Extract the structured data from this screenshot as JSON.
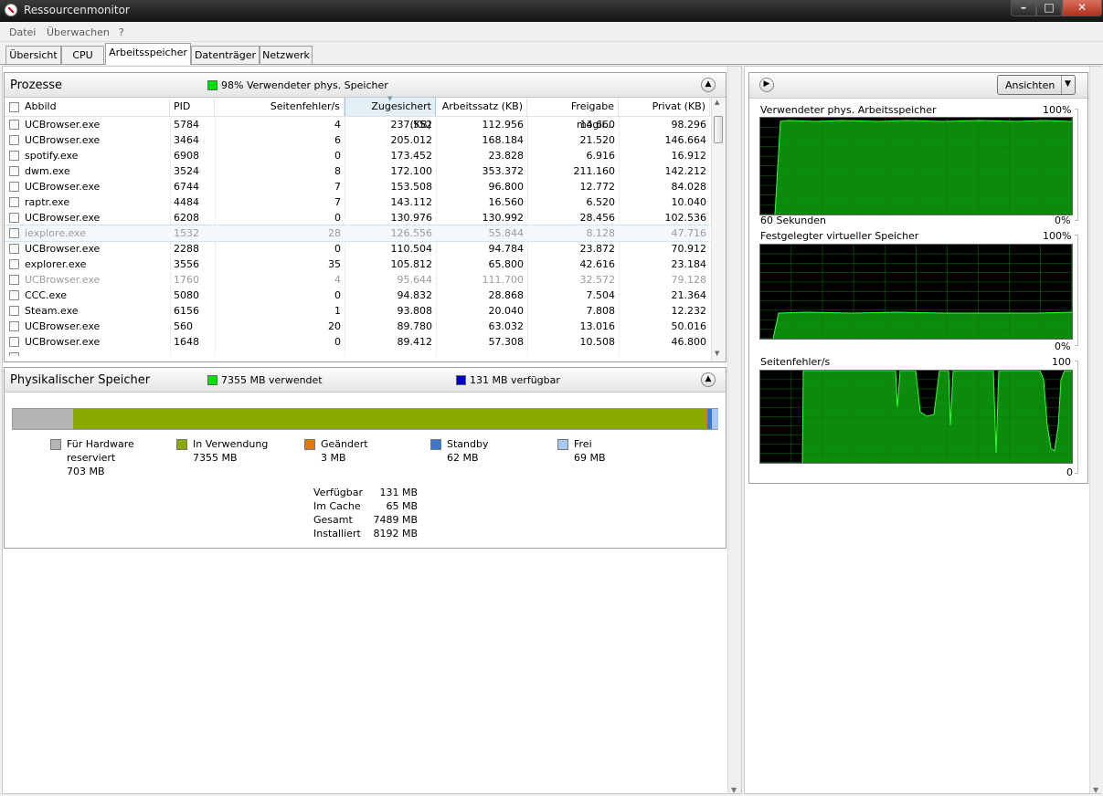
{
  "window": {
    "title": "Ressourcenmonitor"
  },
  "menu": [
    "Datei",
    "Überwachen",
    "?"
  ],
  "tabs": [
    "Übersicht",
    "CPU",
    "Arbeitsspeicher",
    "Datenträger",
    "Netzwerk"
  ],
  "processes": {
    "title": "Prozesse",
    "status": "98% Verwendeter phys. Speicher",
    "status_color": "#00e000",
    "columns": [
      "Abbild",
      "PID",
      "Seitenfehler/s",
      "Zugesichert (KB)",
      "Arbeitssatz (KB)",
      "Freigabe mögli...",
      "Privat (KB)"
    ],
    "rows": [
      {
        "name": "UCBrowser.exe",
        "pid": "5784",
        "faults": "4",
        "commit": "237.552",
        "ws": "112.956",
        "share": "14.660",
        "priv": "98.296",
        "state": "normal"
      },
      {
        "name": "UCBrowser.exe",
        "pid": "3464",
        "faults": "6",
        "commit": "205.012",
        "ws": "168.184",
        "share": "21.520",
        "priv": "146.664",
        "state": "normal"
      },
      {
        "name": "spotify.exe",
        "pid": "6908",
        "faults": "0",
        "commit": "173.452",
        "ws": "23.828",
        "share": "6.916",
        "priv": "16.912",
        "state": "normal"
      },
      {
        "name": "dwm.exe",
        "pid": "3524",
        "faults": "8",
        "commit": "172.100",
        "ws": "353.372",
        "share": "211.160",
        "priv": "142.212",
        "state": "normal"
      },
      {
        "name": "UCBrowser.exe",
        "pid": "6744",
        "faults": "7",
        "commit": "153.508",
        "ws": "96.800",
        "share": "12.772",
        "priv": "84.028",
        "state": "normal"
      },
      {
        "name": "raptr.exe",
        "pid": "4484",
        "faults": "7",
        "commit": "143.112",
        "ws": "16.560",
        "share": "6.520",
        "priv": "10.040",
        "state": "normal"
      },
      {
        "name": "UCBrowser.exe",
        "pid": "6208",
        "faults": "0",
        "commit": "130.976",
        "ws": "130.992",
        "share": "28.456",
        "priv": "102.536",
        "state": "normal"
      },
      {
        "name": "iexplore.exe",
        "pid": "1532",
        "faults": "28",
        "commit": "126.556",
        "ws": "55.844",
        "share": "8.128",
        "priv": "47.716",
        "state": "grey-highlight"
      },
      {
        "name": "UCBrowser.exe",
        "pid": "2288",
        "faults": "0",
        "commit": "110.504",
        "ws": "94.784",
        "share": "23.872",
        "priv": "70.912",
        "state": "normal"
      },
      {
        "name": "explorer.exe",
        "pid": "3556",
        "faults": "35",
        "commit": "105.812",
        "ws": "65.800",
        "share": "42.616",
        "priv": "23.184",
        "state": "normal"
      },
      {
        "name": "UCBrowser.exe",
        "pid": "1760",
        "faults": "4",
        "commit": "95.644",
        "ws": "111.700",
        "share": "32.572",
        "priv": "79.128",
        "state": "grey"
      },
      {
        "name": "CCC.exe",
        "pid": "5080",
        "faults": "0",
        "commit": "94.832",
        "ws": "28.868",
        "share": "7.504",
        "priv": "21.364",
        "state": "normal"
      },
      {
        "name": "Steam.exe",
        "pid": "6156",
        "faults": "1",
        "commit": "93.808",
        "ws": "20.040",
        "share": "7.808",
        "priv": "12.232",
        "state": "normal"
      },
      {
        "name": "UCBrowser.exe",
        "pid": "560",
        "faults": "20",
        "commit": "89.780",
        "ws": "63.032",
        "share": "13.016",
        "priv": "50.016",
        "state": "normal"
      },
      {
        "name": "UCBrowser.exe",
        "pid": "1648",
        "faults": "0",
        "commit": "89.412",
        "ws": "57.308",
        "share": "10.508",
        "priv": "46.800",
        "state": "normal"
      }
    ]
  },
  "physical": {
    "title": "Physikalischer Speicher",
    "used_label": "7355 MB verwendet",
    "used_color": "#00e000",
    "avail_label": "131 MB verfügbar",
    "avail_color": "#0000c0",
    "bar": [
      {
        "key": "hardware",
        "mb": 703,
        "color": "#b4b4b4"
      },
      {
        "key": "inuse",
        "mb": 7355,
        "color": "#88aa00"
      },
      {
        "key": "modified",
        "mb": 3,
        "color": "#e07800"
      },
      {
        "key": "standby",
        "mb": 62,
        "color": "#3c78c8"
      },
      {
        "key": "free",
        "mb": 69,
        "color": "#a8c8f0"
      }
    ],
    "legend": [
      {
        "label1": "Für Hardware",
        "label2": "reserviert",
        "value": "703 MB",
        "color": "#b4b4b4"
      },
      {
        "label1": "In Verwendung",
        "label2": "",
        "value": "7355 MB",
        "color": "#88aa00"
      },
      {
        "label1": "Geändert",
        "label2": "",
        "value": "3 MB",
        "color": "#e07800"
      },
      {
        "label1": "Standby",
        "label2": "",
        "value": "62 MB",
        "color": "#3c78c8"
      },
      {
        "label1": "Frei",
        "label2": "",
        "value": "69 MB",
        "color": "#a8c8f0"
      }
    ],
    "summary": [
      {
        "label": "Verfügbar",
        "value": "131 MB"
      },
      {
        "label": "Im Cache",
        "value": "65 MB"
      },
      {
        "label": "Gesamt",
        "value": "7489 MB"
      },
      {
        "label": "Installiert",
        "value": "8192 MB"
      }
    ]
  },
  "right": {
    "views_button": "Ansichten",
    "graphs": [
      {
        "title": "Verwendeter phys. Arbeitsspeicher",
        "max": "100%",
        "min": "0%",
        "footer": "60 Sekunden"
      },
      {
        "title": "Festgelegter virtueller Speicher",
        "max": "100%",
        "min": "0%",
        "footer": ""
      },
      {
        "title": "Seitenfehler/s",
        "max": "100",
        "min": "0",
        "footer": ""
      }
    ]
  }
}
